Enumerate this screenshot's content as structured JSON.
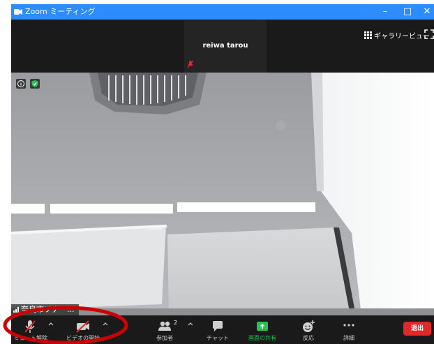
{
  "window": {
    "title": "Zoom ミーティング"
  },
  "titlebar": {
    "minimize": "–",
    "maximize": "□",
    "close": "✕"
  },
  "topstrip": {
    "participant_name": "reiwa tarou",
    "gallery_label": "ギャラリービュー"
  },
  "video": {
    "name_tag": "奈良市ソナー..."
  },
  "toolbar": {
    "mute_label": "ミュート解除",
    "video_label": "ビデオの開始",
    "participants_label": "参加者",
    "participants_count": "2",
    "chat_label": "チャット",
    "share_label": "画面の共有",
    "reactions_label": "反応",
    "more_label": "詳細",
    "leave_label": "退出"
  },
  "colors": {
    "titlebar": "#2d8cff",
    "share_green": "#23c552",
    "leave_red": "#e02828",
    "muted_red": "#e02828",
    "annotation_red": "#cc0000"
  }
}
